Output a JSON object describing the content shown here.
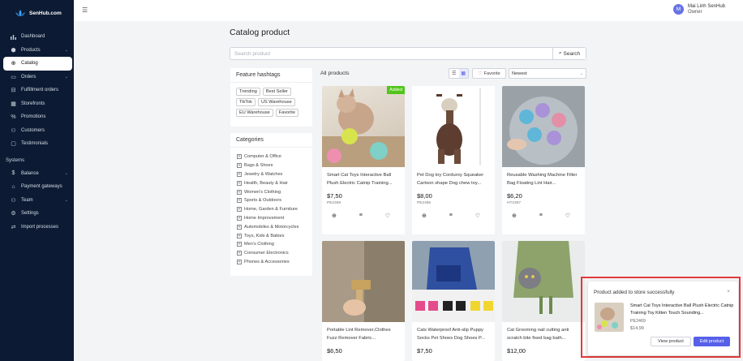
{
  "brand": {
    "name": "SenHub.com"
  },
  "user": {
    "initial": "M",
    "name": "Mai Linh SenHub",
    "role": "Owner"
  },
  "sidebar": {
    "items": [
      {
        "label": "Dashboard",
        "icon": "bar-chart-icon"
      },
      {
        "label": "Products",
        "icon": "box-icon",
        "expandable": true
      },
      {
        "label": "Catalog",
        "icon": "catalog-icon",
        "active": true
      },
      {
        "label": "Orders",
        "icon": "cart-icon",
        "expandable": true
      },
      {
        "label": "Fulfillment orders",
        "icon": "truck-icon"
      },
      {
        "label": "Storefronts",
        "icon": "store-icon"
      },
      {
        "label": "Promotions",
        "icon": "percent-icon"
      },
      {
        "label": "Customers",
        "icon": "users-icon"
      },
      {
        "label": "Testimonials",
        "icon": "chat-icon"
      }
    ],
    "section_label": "Systems",
    "system_items": [
      {
        "label": "Balance",
        "icon": "dollar-icon",
        "expandable": true
      },
      {
        "label": "Payment gateways",
        "icon": "bank-icon"
      },
      {
        "label": "Team",
        "icon": "team-icon",
        "expandable": true
      },
      {
        "label": "Settings",
        "icon": "settings-icon"
      },
      {
        "label": "Import processes",
        "icon": "import-icon"
      }
    ]
  },
  "page": {
    "title": "Catalog product"
  },
  "search": {
    "placeholder": "Search product",
    "value": "",
    "button_label": "Search"
  },
  "hashtags": {
    "title": "Feature hashtags",
    "tags": [
      "Trending",
      "Best Seller",
      "TikTok",
      "US Warehouse",
      "EU Warehouse",
      "Favorite"
    ]
  },
  "categories": {
    "title": "Categories",
    "items": [
      "Computer & Office",
      "Bags & Shoes",
      "Jewelry & Watches",
      "Health, Beauty & Hair",
      "Women's Clothing",
      "Sports & Outdoors",
      "Home, Garden & Furniture",
      "Home Improvement",
      "Automobiles & Motorcycles",
      "Toys, Kids & Babies",
      "Men's Clothing",
      "Consumer Electronics",
      "Phones & Accessories"
    ]
  },
  "toolbar": {
    "all_products_label": "All products",
    "favorite_label": "Favorite",
    "sort_value": "Newest"
  },
  "products": [
    {
      "name": "Smart Cat Toys Interactive Ball Plush Electric Catnip Training...",
      "price": "$7,50",
      "sku": "PE2469",
      "badge": "Added"
    },
    {
      "name": "Pet Dog toy Corduroy Squeaker Cartoon shape Dog chew toy...",
      "price": "$8,00",
      "sku": "PE2466",
      "badge": ""
    },
    {
      "name": "Reusable Washing Machine Filter Bag Floating Lint Hair...",
      "price": "$6,20",
      "sku": "HT2367",
      "badge": ""
    },
    {
      "name": "Portable Lint Remover,Clothes Fuzz Remover Fabric...",
      "price": "$6,50",
      "sku": "",
      "badge": ""
    },
    {
      "name": "Cats Waterproof Anti-slip Puppy Socks Pet Shoes Dog Shoes P...",
      "price": "$7,50",
      "sku": "",
      "badge": ""
    },
    {
      "name": "Cat Grooming nail cutting anti scratch bite fixed bag bath...",
      "price": "$12,00",
      "sku": "",
      "badge": ""
    }
  ],
  "toast": {
    "title": "Product added to store successfully",
    "product_name": "Smart Cat Toys Interactive Ball Plush Electric Catnip Training Toy Kitten Touch Sounding...",
    "sku": "PE2469",
    "price": "$14,99",
    "view_label": "View product",
    "edit_label": "Edit product"
  },
  "colors": {
    "sidebar_bg": "#0c1b33",
    "accent": "#5660e8",
    "success": "#52c41a",
    "toast_border": "#e23a3a"
  }
}
